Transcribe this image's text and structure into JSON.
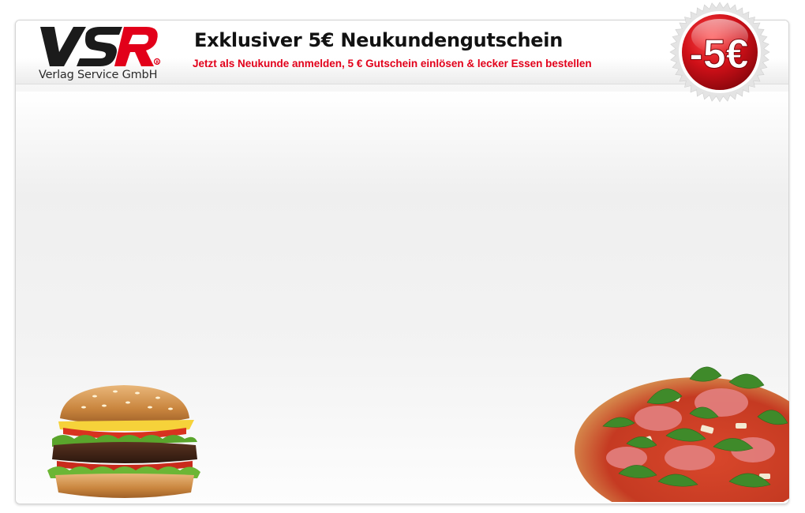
{
  "brand": {
    "logo_text": "VSR",
    "subtitle": "Verlag Service GmbH"
  },
  "promo": {
    "headline": "Exklusiver 5€ Neukundengutschein",
    "subline": "Jetzt als Neukunde anmelden, 5 € Gutschein einlösen & lecker Essen bestellen",
    "badge_text": "-5€"
  },
  "colors": {
    "brand_red": "#e2001a",
    "brand_dark": "#1b1b1b",
    "badge_red": "#c8111b"
  },
  "images": {
    "burger": "burger-image",
    "pizza": "pizza-image"
  }
}
